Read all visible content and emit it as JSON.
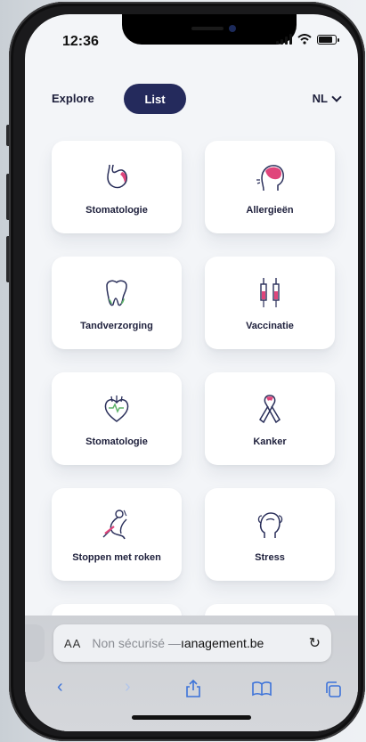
{
  "status": {
    "time": "12:36"
  },
  "nav": {
    "explore": "Explore",
    "list": "List",
    "lang": "NL"
  },
  "cards": [
    {
      "label": "Stomatologie",
      "icon": "stomach-icon"
    },
    {
      "label": "Allergieën",
      "icon": "head-allergy-icon"
    },
    {
      "label": "Tandverzorging",
      "icon": "tooth-icon"
    },
    {
      "label": "Vaccinatie",
      "icon": "syringe-icon"
    },
    {
      "label": "Stomatologie",
      "icon": "heart-icon"
    },
    {
      "label": "Kanker",
      "icon": "ribbon-icon"
    },
    {
      "label": "Stoppen met roken",
      "icon": "smoking-icon"
    },
    {
      "label": "Stress",
      "icon": "stress-head-icon"
    }
  ],
  "browser": {
    "aa": "AA",
    "url_security": "Non sécurisé —",
    "url_host": "ıanagement.be"
  },
  "colors": {
    "accent": "#242a5c",
    "pink": "#e0457b",
    "green": "#5fb36a",
    "browser_blue": "#3d73d9"
  }
}
